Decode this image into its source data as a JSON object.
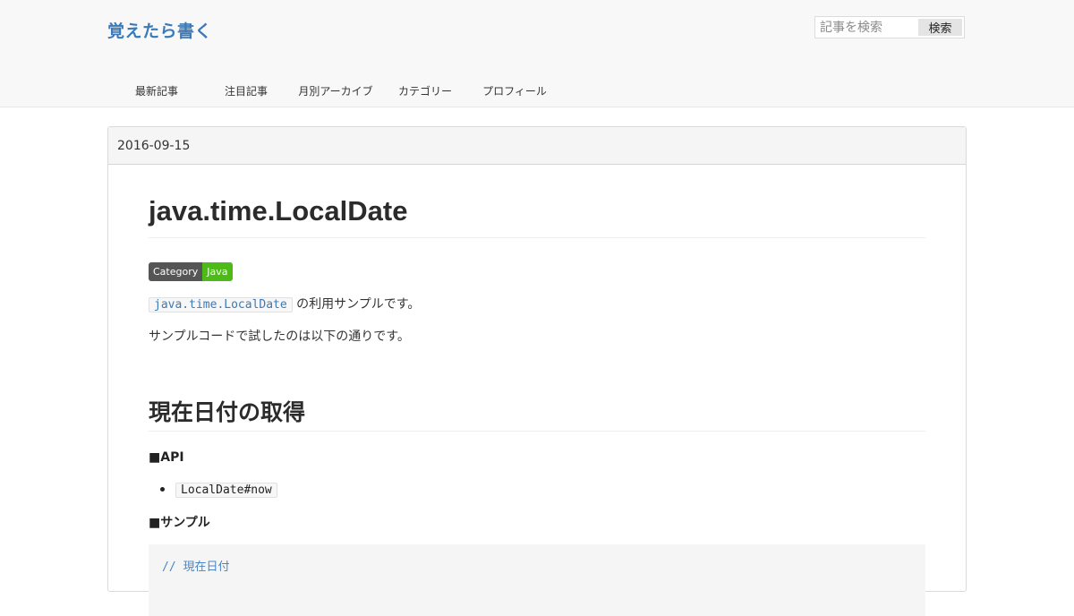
{
  "header": {
    "blog_title": "覚えたら書く",
    "search": {
      "placeholder": "記事を検索",
      "button_label": "検索"
    },
    "nav": [
      "最新記事",
      "注目記事",
      "月別アーカイブ",
      "カテゴリー",
      "プロフィール"
    ]
  },
  "entry": {
    "date": "2016-09-15",
    "title": "java.time.LocalDate",
    "category": {
      "key": "Category",
      "value": "Java"
    },
    "intro_code": "java.time.LocalDate",
    "intro_text": "の利用サンプルです。",
    "intro_text2": "サンプルコードで試したのは以下の通りです。",
    "section": {
      "heading": "現在日付の取得",
      "api_label": "■API",
      "api_item": "LocalDate#now",
      "sample_label": "■サンプル",
      "code_comment": "// 現在日付"
    }
  },
  "colors": {
    "accent": "#3b79b8",
    "badge_value": "#4cbb17",
    "badge_key": "#555555"
  }
}
